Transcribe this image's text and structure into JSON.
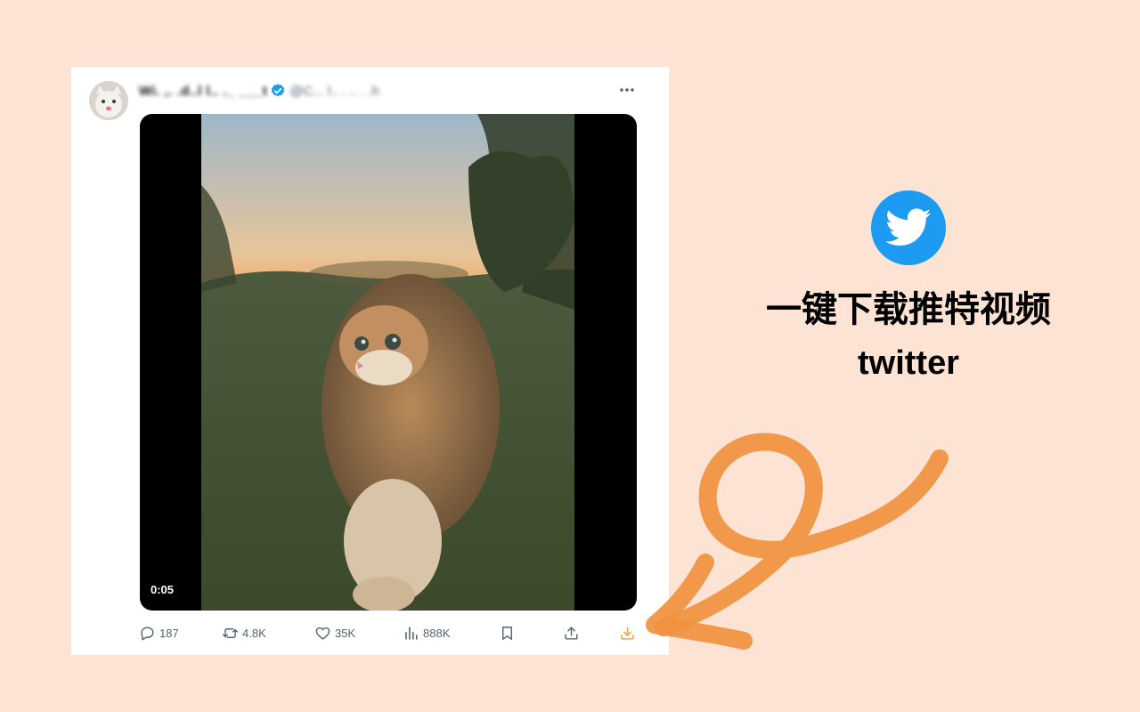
{
  "tweet": {
    "display_name": "Wi. ,. .d..l l.. ._ ___t",
    "handle": "@C... l..  . .. . .h",
    "video": {
      "duration": "0:05"
    },
    "actions": {
      "replies": "187",
      "retweets": "4.8K",
      "likes": "35K",
      "views": "888K"
    }
  },
  "promo": {
    "headline": "一键下载推特视频",
    "subheadline": "twitter"
  },
  "colors": {
    "background": "#fde3d4",
    "twitter_blue": "#1d9bf0",
    "arrow_orange": "#f0913f",
    "icon_gray": "#536471",
    "download_orange": "#f29a3f"
  }
}
